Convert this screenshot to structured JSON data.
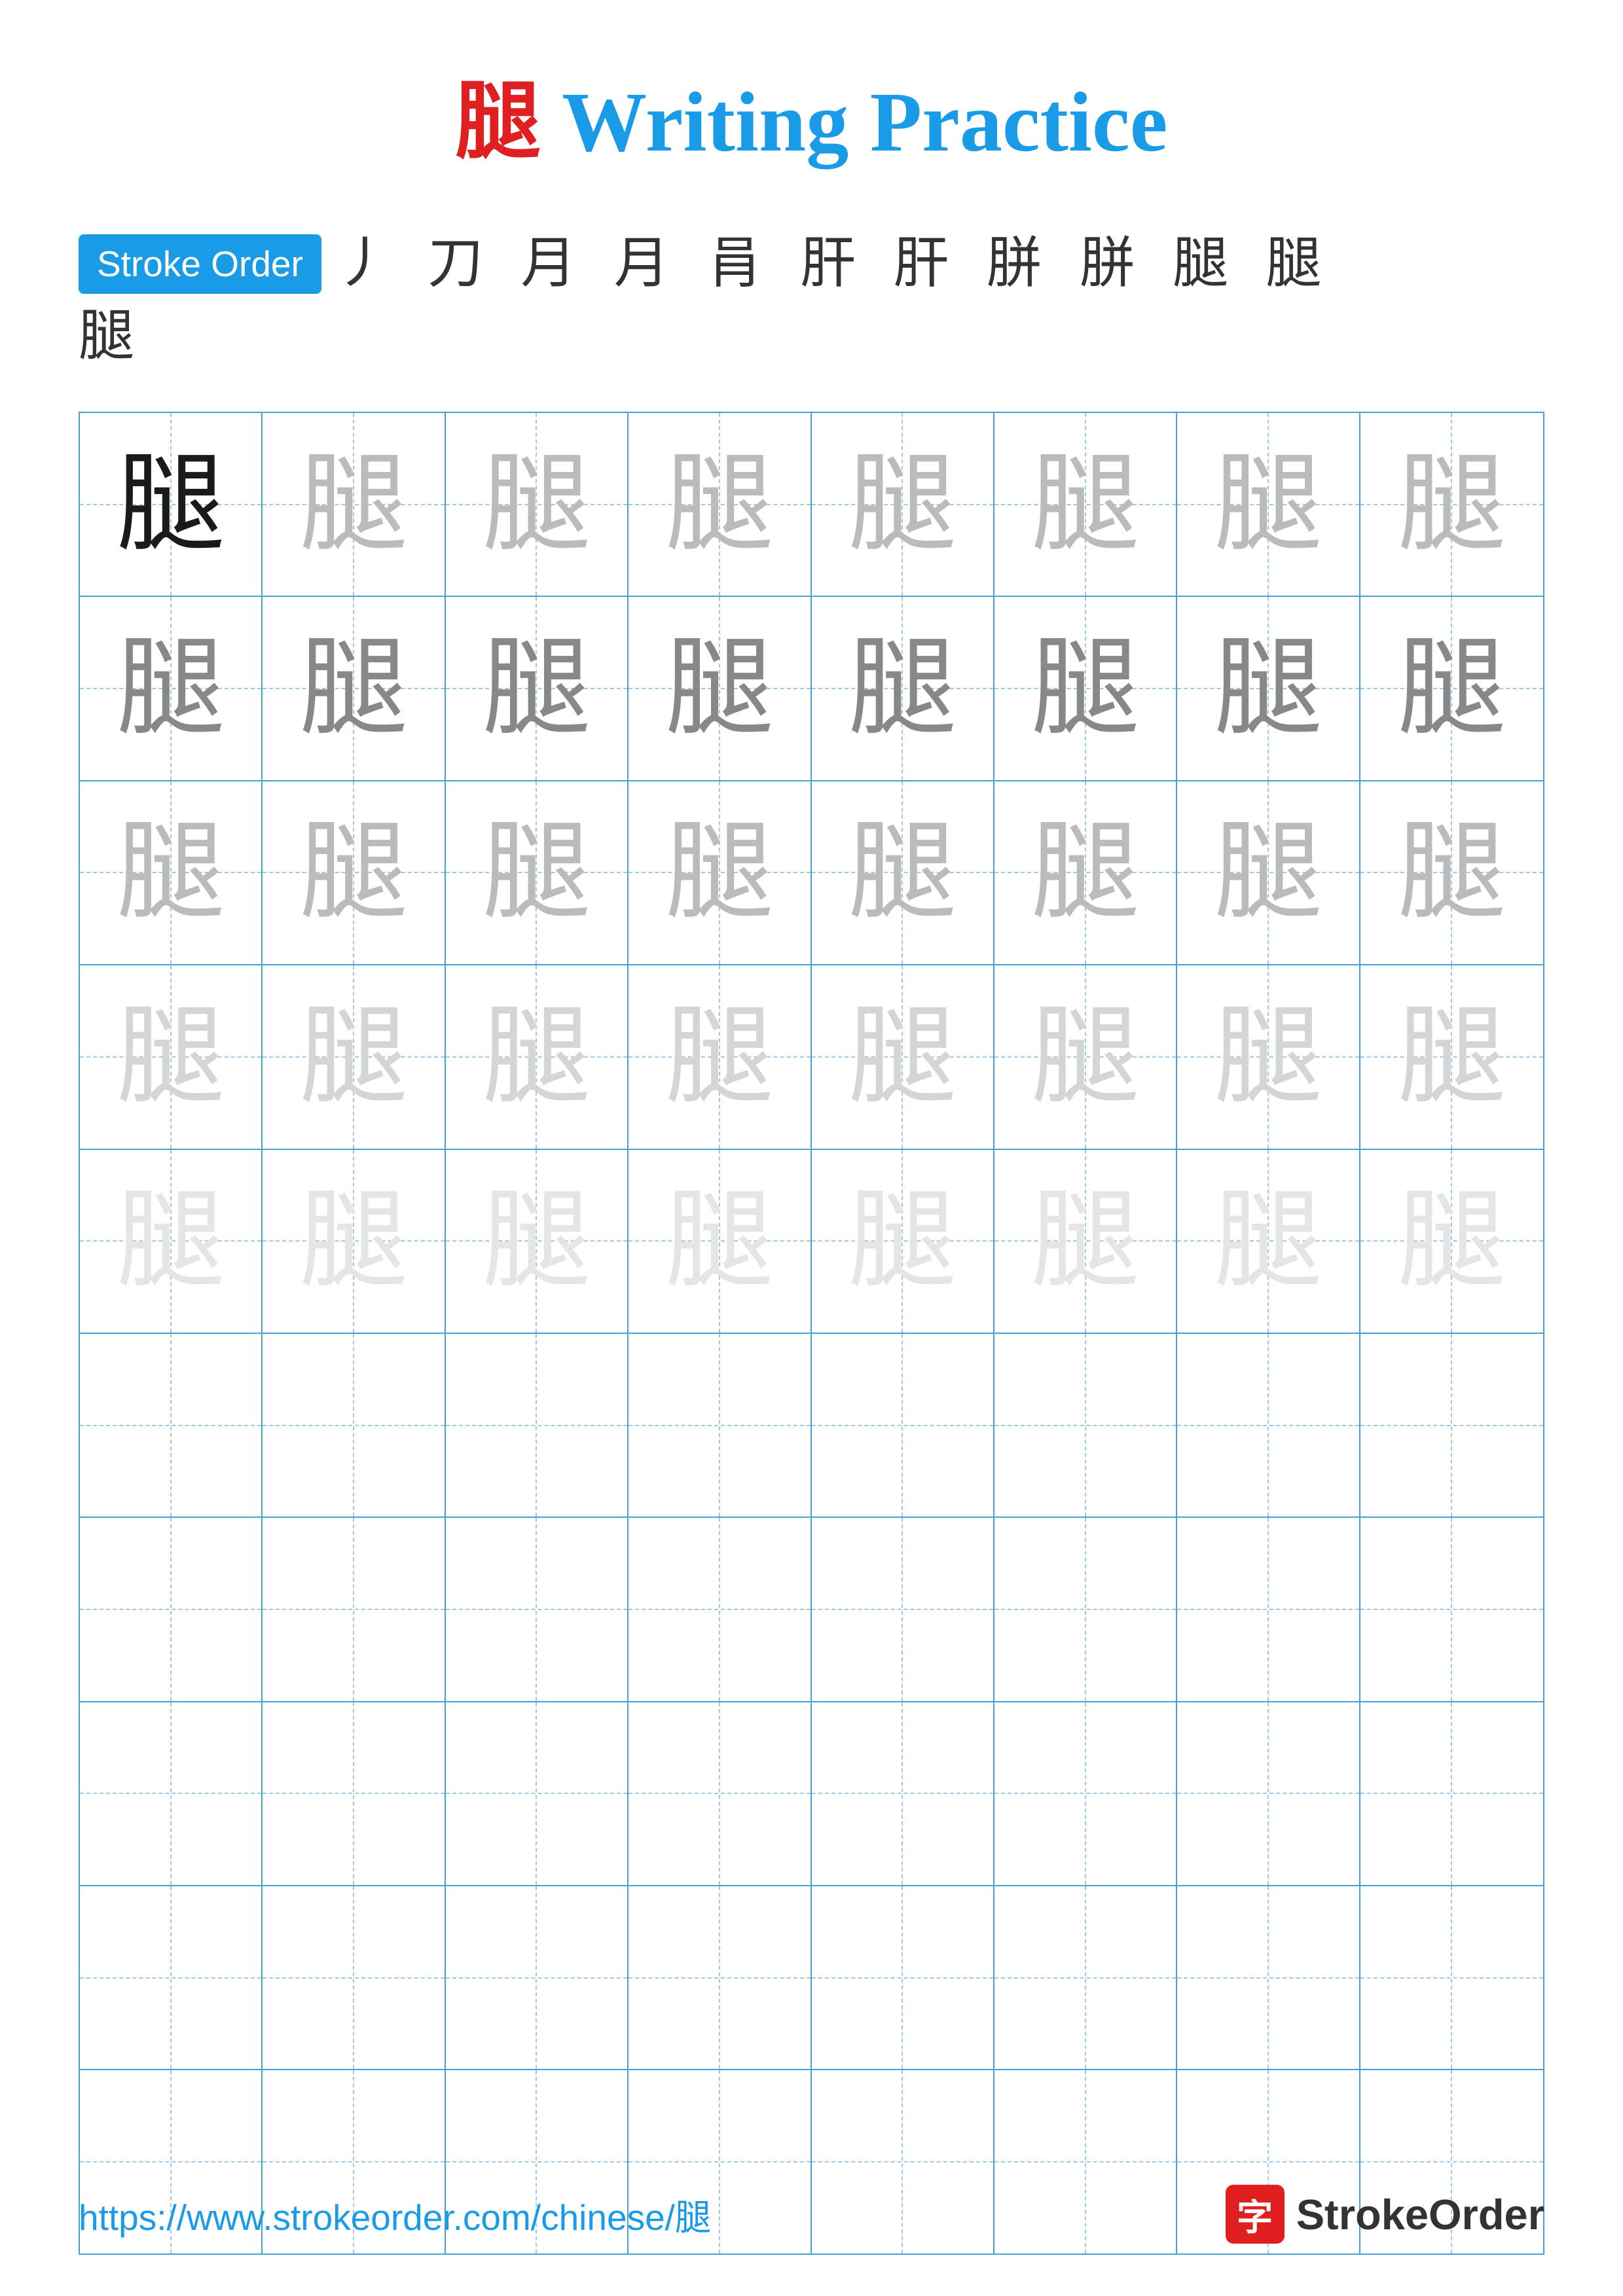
{
  "title": {
    "prefix_char": "腿",
    "suffix": " Writing Practice"
  },
  "stroke_order": {
    "badge_label": "Stroke Order",
    "strokes_line1": "丿 刀 月 月 肙 肝 肝 胼 胼 腿 腿",
    "strokes_line2": "腿"
  },
  "grid": {
    "rows": 10,
    "cols": 8,
    "character": "腿",
    "opacity_rows": [
      [
        "dark",
        "light",
        "light",
        "light",
        "light",
        "light",
        "light",
        "light"
      ],
      [
        "medium",
        "medium",
        "medium",
        "medium",
        "medium",
        "medium",
        "medium",
        "medium"
      ],
      [
        "light",
        "light",
        "light",
        "light",
        "light",
        "light",
        "light",
        "light"
      ],
      [
        "very-light",
        "very-light",
        "very-light",
        "very-light",
        "very-light",
        "very-light",
        "very-light",
        "very-light"
      ],
      [
        "ultra-light",
        "ultra-light",
        "ultra-light",
        "ultra-light",
        "ultra-light",
        "ultra-light",
        "ultra-light",
        "ultra-light"
      ],
      [
        "empty",
        "empty",
        "empty",
        "empty",
        "empty",
        "empty",
        "empty",
        "empty"
      ],
      [
        "empty",
        "empty",
        "empty",
        "empty",
        "empty",
        "empty",
        "empty",
        "empty"
      ],
      [
        "empty",
        "empty",
        "empty",
        "empty",
        "empty",
        "empty",
        "empty",
        "empty"
      ],
      [
        "empty",
        "empty",
        "empty",
        "empty",
        "empty",
        "empty",
        "empty",
        "empty"
      ],
      [
        "empty",
        "empty",
        "empty",
        "empty",
        "empty",
        "empty",
        "empty",
        "empty"
      ]
    ]
  },
  "footer": {
    "url": "https://www.strokeorder.com/chinese/腿",
    "logo_char": "字",
    "logo_text": "StrokeOrder"
  }
}
